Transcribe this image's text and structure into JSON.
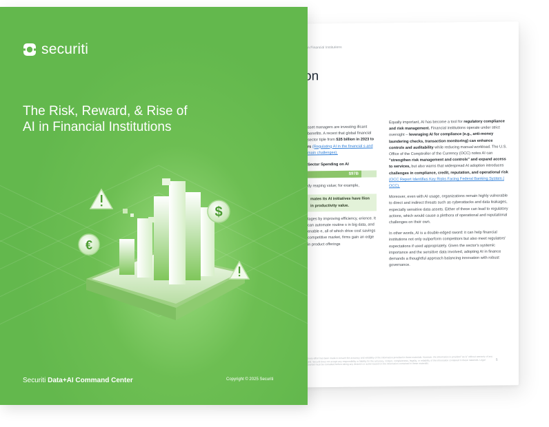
{
  "back_page": {
    "header": "in Financial Institutions",
    "heading": "on",
    "left_column": {
      "p1": "sset managers are investing ificant benefits. A recent that global financial sector tiple from",
      "p1_bold": "$35 billion in 2023 to",
      "p1_tail": "rs",
      "p1_link": "(Regulating AI in the financial s and main challenges).",
      "chart_title": "Sector Spending on AI",
      "chart_bar_value": "$97B",
      "chart_bar_fill": 0.78,
      "p2": "dy reaping value; for example,",
      "highlight": "mates its AI initiatives have llion in productivity value.",
      "p3": "tages by improving efficiency, erience. It can automate routine s in big data, and enable e, all of which drive cost savings competitive market, firms gain an edge in product offerings"
    },
    "right_column": {
      "p1_a": "Equally important, AI has become a tool for",
      "p1_b": "regulatory compliance and risk management.",
      "p1_c": "Financial institutions operate under strict oversight –",
      "p1_d": "leveraging AI for compliance (e.g., anti-money laundering checks, transaction monitoring) can enhance controls and auditability",
      "p1_e": "while reducing manual workload. The U.S. Office of the Comptroller of the Currency (OCC) notes AI can",
      "p1_f": "\"strengthen risk management and controls\" and expand access to services,",
      "p1_g": "but also warns that widespread AI adoption introduces",
      "p1_h": "challenges in compliance, credit, reputation, and operational risk",
      "p1_link": "(OCC Report Identifies Key Risks Facing Federal Banking System | OCC).",
      "p2": "Moreover, even with AI usage, organizations remain highly vulnerable to direct and indirect threats such as cyberattacks and data leakages, especially sensitive data assets. Either of these can lead to regulatory actions, which would cause a plethora of operational and reputational challenges on their own.",
      "p3": "In other words, AI is a double-edged sword: it can help financial institutions not only outperform competitors but also meet regulators' expectations if used appropriately. Given the sector's systemic importance and the sensitive data involved, adopting AI in finance demands a thoughtful approach balancing innovation with robust governance."
    },
    "footer_note": "Every effort has been made to ensure the accuracy and reliability of the information provided in these materials. However, the information is provided \"as is\" without warranty of any kind. Securiti does not accept any responsibility or liability for the accuracy, content, completeness, legality, or reliability of the information contained in these materials. Legal counsel must be consulted before taking any decision or action based on the information contained in these materials.",
    "page_number": "5"
  },
  "cover": {
    "brand": "securiti",
    "title_line1": "The Risk, Reward, & Rise of",
    "title_line2": "AI in Financial Institutions",
    "footer_brand": "Securiti",
    "footer_product": "Data+AI Command Center",
    "copyright": "Copyright © 2025 Securiti",
    "icons": [
      "warning-icon",
      "dollar-icon",
      "euro-icon",
      "warning-icon"
    ]
  },
  "colors": {
    "cover_green": "#63b84d",
    "light_green": "#d4ebc7",
    "bar_green": "#8cc56a",
    "link_blue": "#2f7fd8"
  }
}
